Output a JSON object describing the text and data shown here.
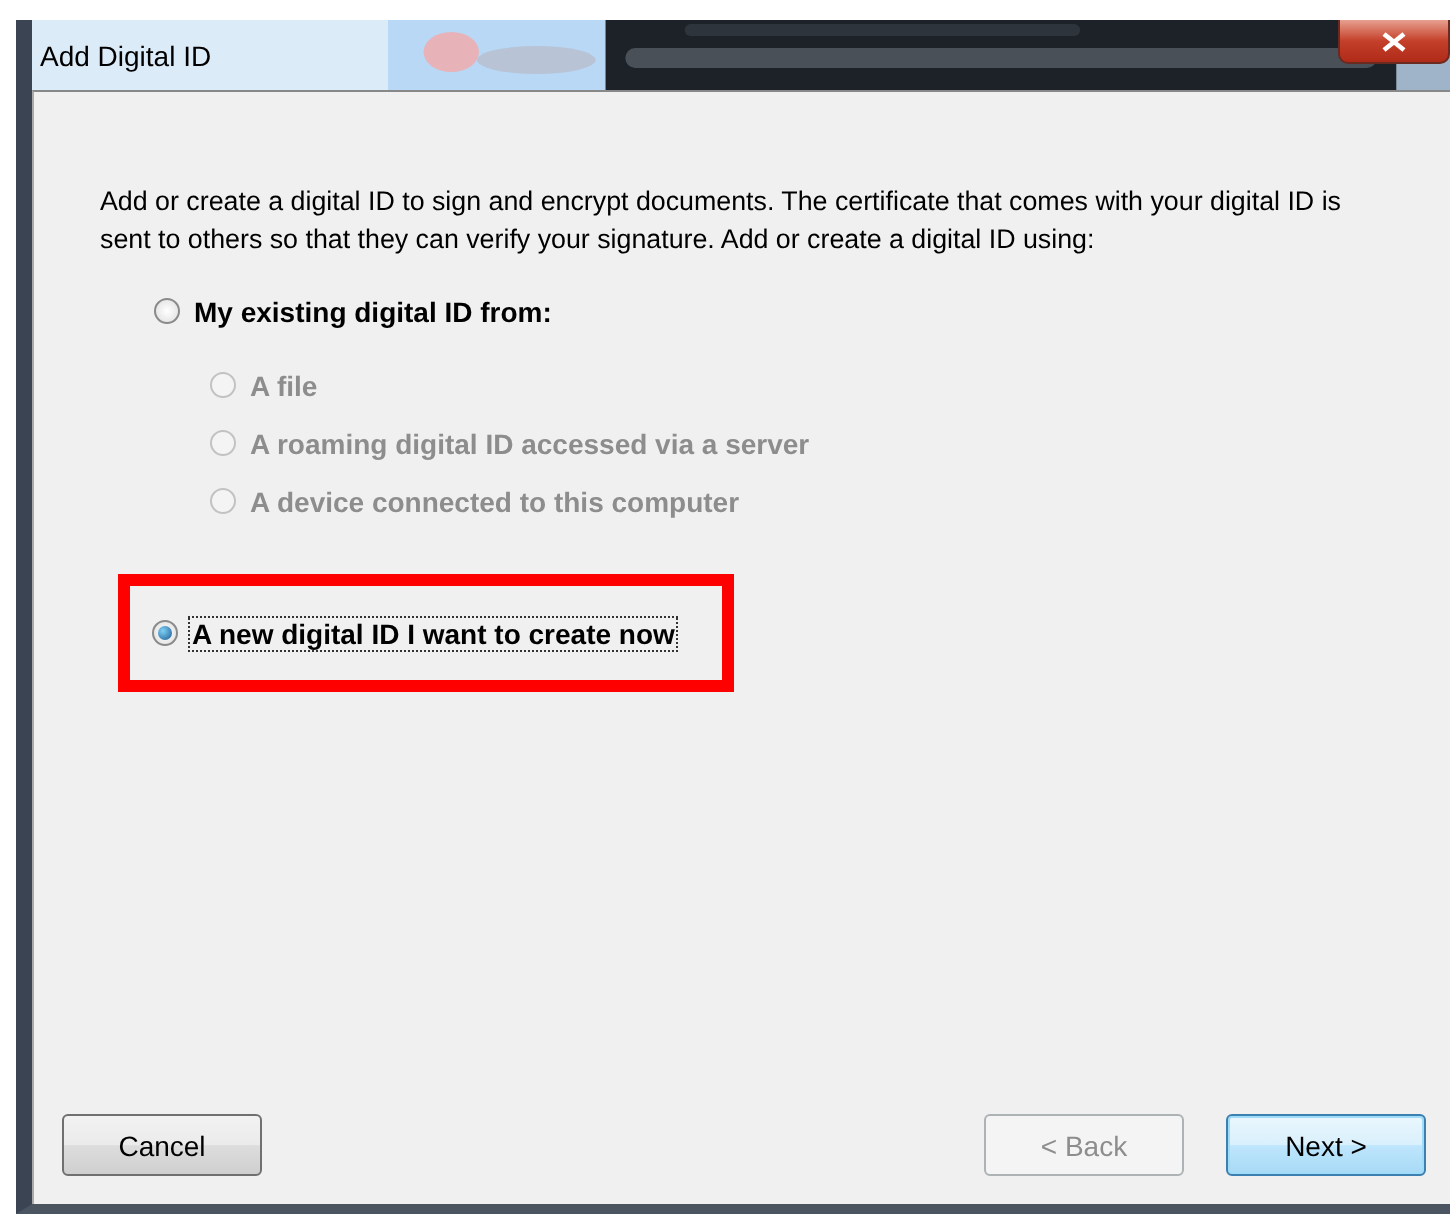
{
  "window": {
    "title": "Add Digital ID"
  },
  "intro": "Add or create a digital ID to sign and encrypt documents. The certificate that comes with your digital ID is sent to others so that they can verify your signature. Add or create a digital ID using:",
  "options": [
    {
      "label": "My existing digital ID from:",
      "selected": false,
      "disabled": false,
      "focused": false,
      "highlighted": false,
      "children": [
        {
          "label": "A file",
          "selected": false,
          "disabled": true
        },
        {
          "label": "A roaming digital ID accessed via a server",
          "selected": false,
          "disabled": true
        },
        {
          "label": "A device connected to this computer",
          "selected": false,
          "disabled": true
        }
      ]
    },
    {
      "label": "A new digital ID I want to create now",
      "selected": true,
      "disabled": false,
      "focused": true,
      "highlighted": true
    }
  ],
  "buttons": [
    {
      "label": "Cancel",
      "disabled": false,
      "default": false
    },
    {
      "label": "< Back",
      "disabled": true,
      "default": false
    },
    {
      "label": "Next >",
      "disabled": false,
      "default": true
    }
  ]
}
